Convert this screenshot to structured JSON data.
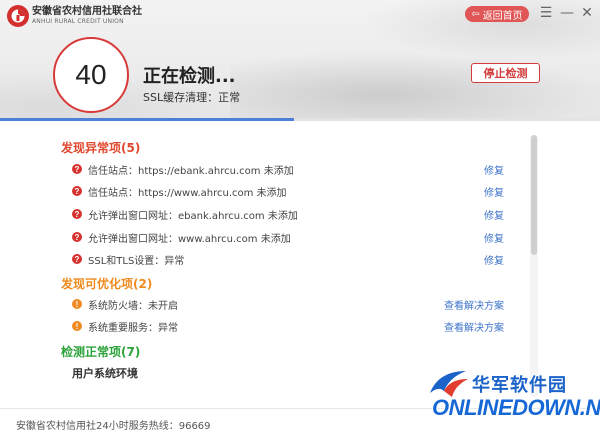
{
  "brand": {
    "name_cn": "安徽省农村信用社联合社",
    "name_en": "ANHUI RURAL CREDIT UNION"
  },
  "header": {
    "home_label": "返回首页",
    "score": "40",
    "status_title": "正在检测...",
    "status_sub": "SSL缓存清理：正常",
    "stop_label": "停止检测",
    "progress": 0.49
  },
  "sections": {
    "abnormal": {
      "title": "发现异常项(5)",
      "items": [
        {
          "text": "信任站点：https://ebank.ahrcu.com 未添加",
          "action": "修复"
        },
        {
          "text": "信任站点：https://www.ahrcu.com 未添加",
          "action": "修复"
        },
        {
          "text": "允许弹出窗口网址：ebank.ahrcu.com 未添加",
          "action": "修复"
        },
        {
          "text": "允许弹出窗口网址：www.ahrcu.com 未添加",
          "action": "修复"
        },
        {
          "text": "SSL和TLS设置：异常",
          "action": "修复"
        }
      ]
    },
    "optimizable": {
      "title": "发现可优化项(2)",
      "items": [
        {
          "text": "系统防火墙：未开启",
          "action": "查看解决方案"
        },
        {
          "text": "系统重要服务：异常",
          "action": "查看解决方案"
        }
      ]
    },
    "normal": {
      "title": "检测正常项(7)",
      "items": [
        {
          "text": "用户系统环境"
        }
      ]
    }
  },
  "footer": {
    "hotline": "安徽省农村信用社24小时服务热线：96669"
  },
  "watermark": {
    "cn": "华军软件园",
    "en": "ONLINEDOWN.NET"
  },
  "colors": {
    "accent_red": "#d83a3a",
    "abnormal": "#e0492f",
    "optimizable": "#ef8a1e",
    "normal": "#2ca23a",
    "link": "#3f74c9",
    "progress": "#4f7fd8"
  }
}
